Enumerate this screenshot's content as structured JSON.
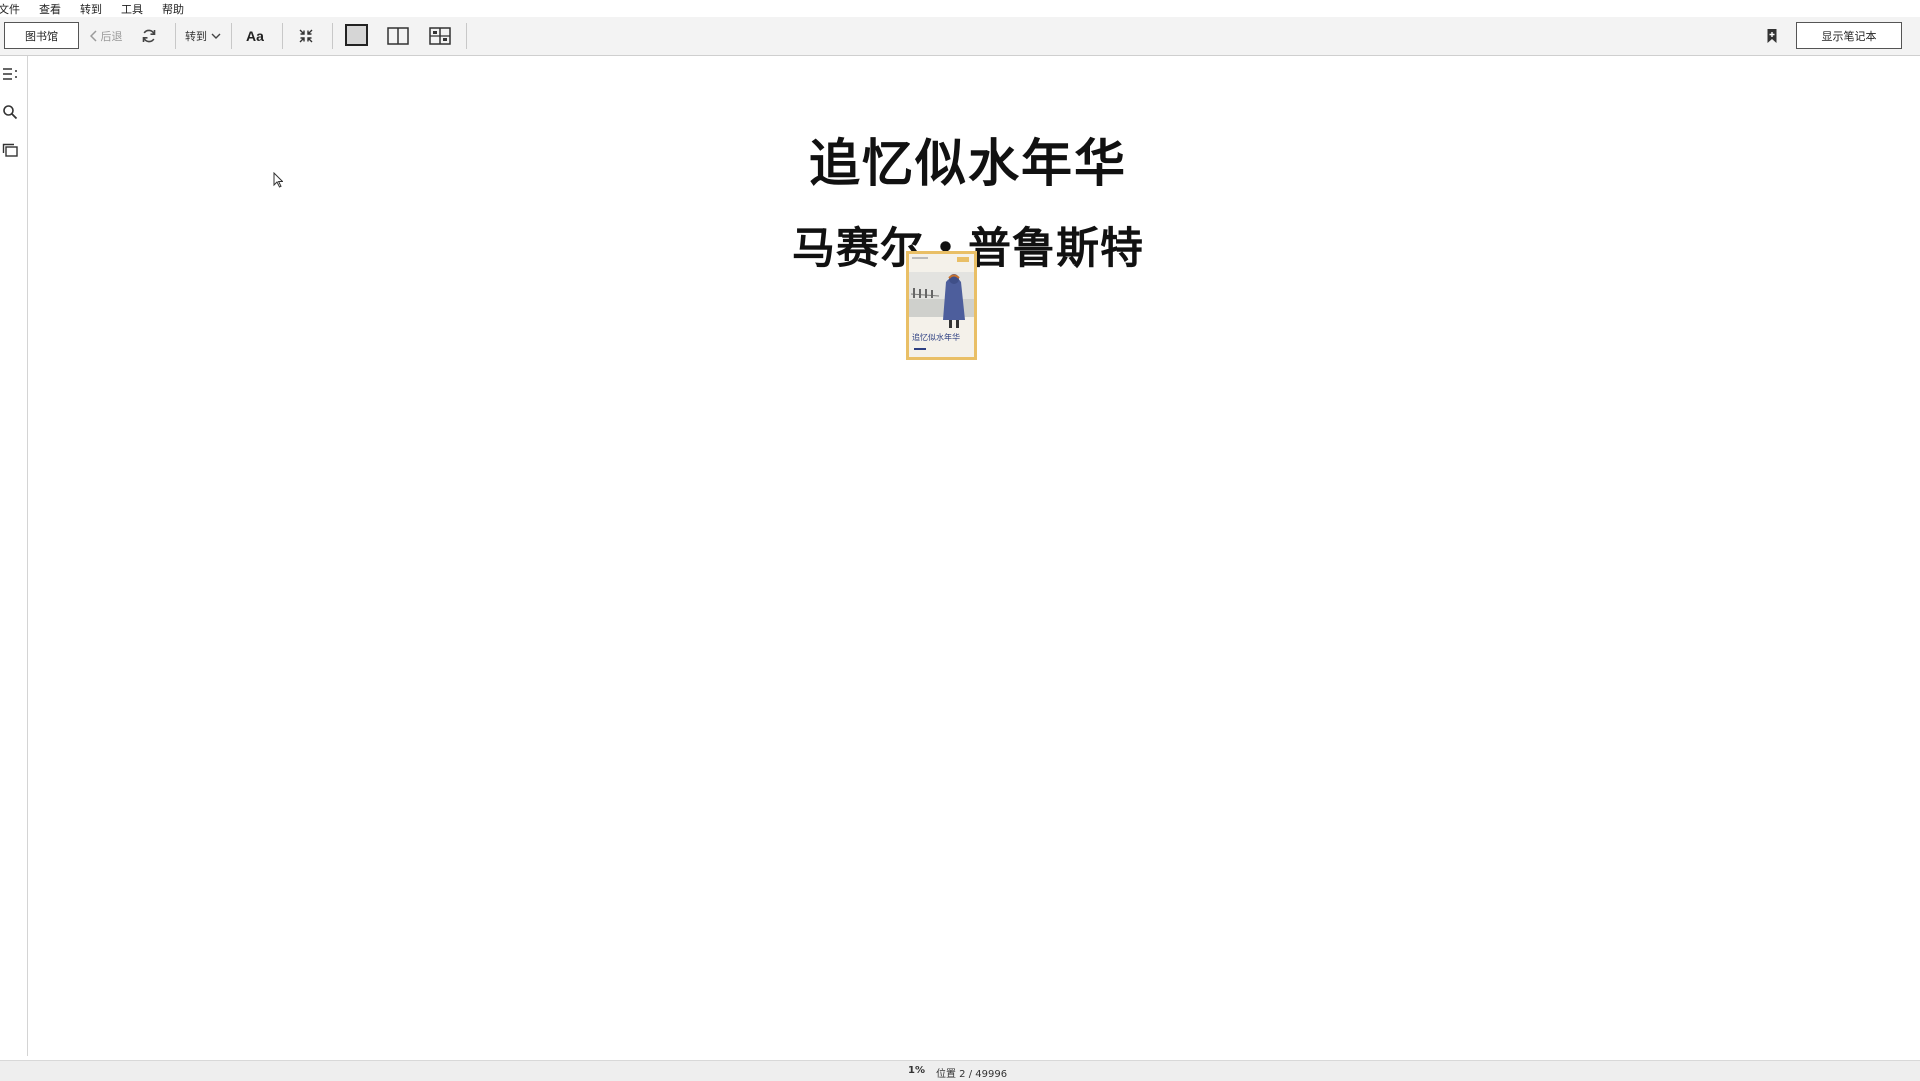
{
  "menu": {
    "items": [
      "文件",
      "查看",
      "转到",
      "工具",
      "帮助"
    ]
  },
  "toolbar": {
    "library_label": "图书馆",
    "back_label": "后退",
    "goto_label": "转到",
    "font_label": "Aa",
    "notebook_label": "显示笔记本"
  },
  "book": {
    "title": "追忆似水年华",
    "author": "马赛尔・普鲁斯特",
    "cover_text": "追忆似水年华"
  },
  "status": {
    "percent": "1%",
    "location": "位置 2 / 49996"
  },
  "colors": {
    "cover_border": "#e9bf66",
    "toolbar_bg": "#f3f3f3"
  },
  "icons": [
    "chevron-left-icon",
    "refresh-icon",
    "chevron-down-icon",
    "fullscreen-icon",
    "single-page-icon",
    "two-page-icon",
    "scroll-layout-icon",
    "bookmark-icon",
    "toc-icon",
    "search-icon",
    "thumbnails-icon"
  ]
}
